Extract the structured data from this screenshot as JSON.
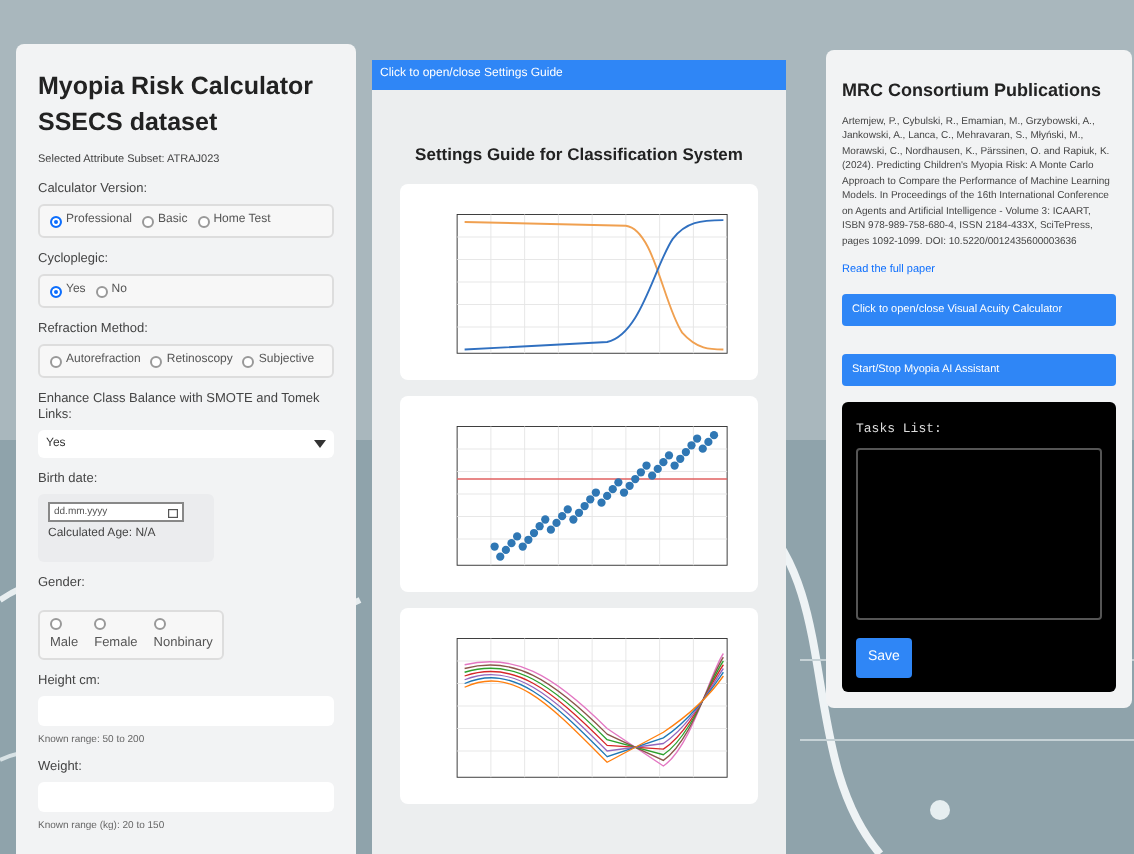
{
  "calculator": {
    "title": "Myopia Risk Calculator SSECS dataset",
    "subset": "Selected Attribute Subset: ATRAJ023",
    "fields": [
      {
        "kind": "radio",
        "label": "Calculator Version:",
        "options": [
          {
            "label": "Professional",
            "selected": true
          },
          {
            "label": "Basic",
            "selected": false
          },
          {
            "label": "Home Test",
            "selected": false
          }
        ]
      },
      {
        "kind": "radio",
        "label": "Cycloplegic:",
        "options": [
          {
            "label": "Yes",
            "selected": true
          },
          {
            "label": "No",
            "selected": false
          }
        ]
      },
      {
        "kind": "radio",
        "label": "Refraction Method:",
        "options": [
          {
            "label": "Autorefraction",
            "selected": false
          },
          {
            "label": "Retinoscopy",
            "selected": false
          },
          {
            "label": "Subjective",
            "selected": false
          }
        ]
      },
      {
        "kind": "select",
        "label": "Enhance Class Balance with SMOTE and Tomek Links:",
        "value": "Yes"
      },
      {
        "kind": "date",
        "label": "Birth date:",
        "placeholder": "dd.mm.yyyy",
        "note": "Calculated Age: N/A"
      },
      {
        "kind": "stacked_radio",
        "label": "Gender:",
        "options": [
          {
            "label": "Male",
            "selected": false
          },
          {
            "label": "Female",
            "selected": false
          },
          {
            "label": "Nonbinary",
            "selected": false
          }
        ]
      },
      {
        "kind": "number",
        "label": "Height cm:",
        "hint": "Known range: 50 to 200"
      },
      {
        "kind": "number",
        "label": "Weight:",
        "hint": "Known range (kg): 20 to 150"
      }
    ]
  },
  "guide": {
    "toggle": "Click to open/close Settings Guide",
    "title": "Settings Guide for Classification System",
    "figures": [
      {
        "kind": "line"
      },
      {
        "kind": "scatter"
      },
      {
        "kind": "multiline"
      }
    ]
  },
  "publications": {
    "title": "MRC Consortium Publications",
    "citation": "Artemjew, P., Cybulski, R., Emamian, M., Grzybowski, A., Jankowski, A., Lanca, C., Mehravaran, S., Młyński, M., Morawski, C., Nordhausen, K., Pärssinen, O. and Rapiuk, K. (2024). Predicting Children's Myopia Risk: A Monte Carlo Approach to Compare the Performance of Machine Learning Models. In Proceedings of the 16th International Conference on Agents and Artificial Intelligence - Volume 3: ICAART, ISBN 978-989-758-680-4, ISSN 2184-433X, SciTePress, pages 1092-1099. DOI: 10.5220/0012435600003636",
    "link": "Read the full paper",
    "buttons": [
      "Click to open/close Visual Acuity Calculator",
      "Start/Stop Myopia AI Assistant"
    ],
    "tasks": {
      "label": "Tasks List:",
      "save": "Save"
    }
  }
}
